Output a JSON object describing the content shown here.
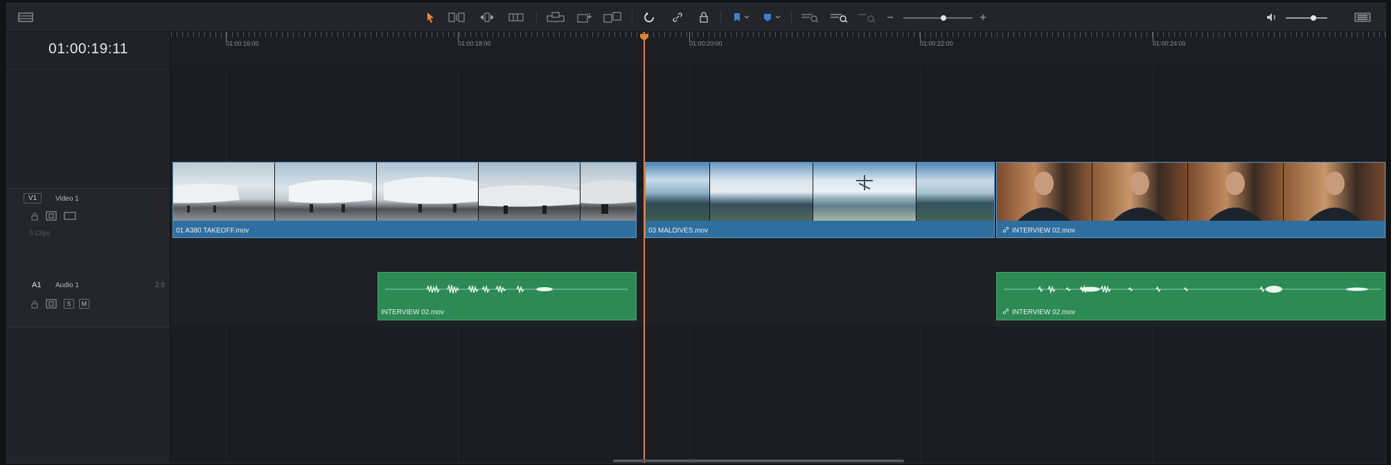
{
  "timecode": "01:00:19:11",
  "ruler": {
    "labels": [
      "01:00:16:00",
      "01:00:18:00",
      "01:00:20:00",
      "01:00:22:00",
      "01:00:24:00"
    ]
  },
  "tracks": {
    "video": {
      "tag": "V1",
      "name": "Video 1",
      "clip_count": "5 Clips"
    },
    "audio": {
      "tag": "A1",
      "name": "Audio 1",
      "channels": "2.0",
      "solo": "S",
      "mute": "M"
    }
  },
  "clips": {
    "video": [
      {
        "label": "01 A380 TAKEOFF.mov"
      },
      {
        "label": "03 MALDIVES.mov"
      },
      {
        "label": "INTERVIEW 02.mov",
        "linked": true
      }
    ],
    "audio": [
      {
        "label": "INTERVIEW 02.mov"
      },
      {
        "label": "INTERVIEW 02.mov",
        "linked": true
      }
    ]
  },
  "icons": [
    "layout-icon",
    "selection-arrow-icon",
    "trim-edit-icon",
    "dynamic-trim-icon",
    "blade-icon",
    "insert-clip-icon",
    "overwrite-clip-icon",
    "replace-clip-icon",
    "snapping-icon",
    "linked-selection-icon",
    "position-lock-icon",
    "flag-icon",
    "marker-icon",
    "zoom-to-fit-icon",
    "zoom-detail-icon",
    "custom-zoom-icon",
    "zoom-out-icon",
    "zoom-in-icon",
    "speaker-icon",
    "meter-icon"
  ],
  "colors": {
    "playhead": "#e0823f",
    "video_clip": "#2f6f9f",
    "audio_clip": "#2d8a55",
    "accent_orange": "#e8893b",
    "accent_blue": "#3c7fd6"
  },
  "zoom_level": 0.42,
  "volume_level": 0.6
}
